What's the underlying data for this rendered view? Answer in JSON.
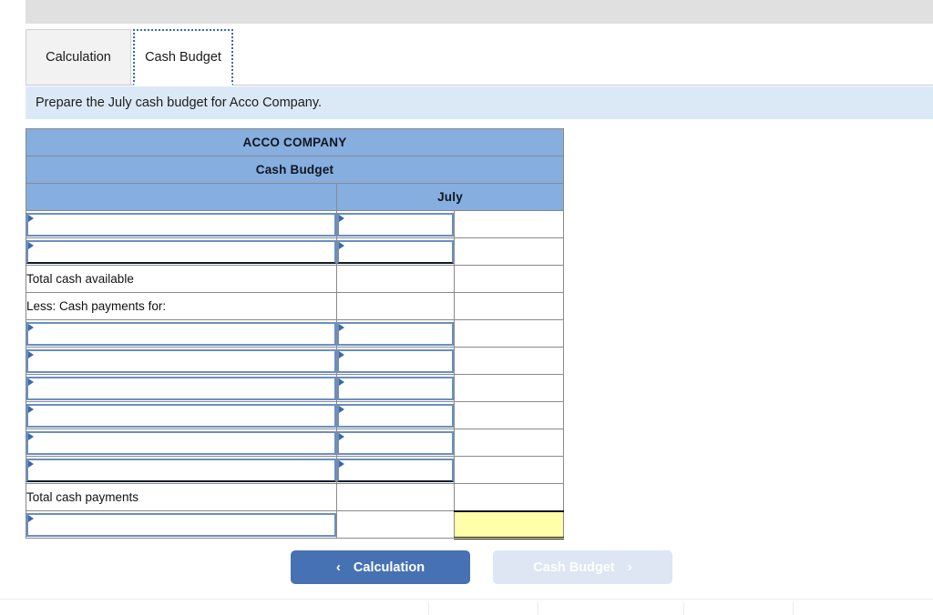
{
  "tabs": [
    {
      "label": "Calculation",
      "active": false
    },
    {
      "label": "Cash Budget",
      "active": true
    }
  ],
  "banner": {
    "text": "Prepare the July cash budget for Acco Company."
  },
  "sheet": {
    "company": "ACCO COMPANY",
    "statement": "Cash Budget",
    "blank_header": "",
    "period": "July",
    "rows": [
      {
        "kind": "input",
        "label": "",
        "b": "input",
        "c": "plain",
        "subline": false
      },
      {
        "kind": "input",
        "label": "",
        "b": "input",
        "c": "plain",
        "subline": true
      },
      {
        "kind": "label",
        "label": "Total cash available",
        "b": "plain",
        "c": "plain",
        "subline": false
      },
      {
        "kind": "label",
        "label": "Less: Cash payments for:",
        "b": "plain",
        "c": "plain",
        "subline": false
      },
      {
        "kind": "input",
        "label": "",
        "b": "input",
        "c": "plain",
        "subline": false
      },
      {
        "kind": "input",
        "label": "",
        "b": "input",
        "c": "plain",
        "subline": false
      },
      {
        "kind": "input",
        "label": "",
        "b": "input",
        "c": "plain",
        "subline": false
      },
      {
        "kind": "input",
        "label": "",
        "b": "input",
        "c": "plain",
        "subline": false
      },
      {
        "kind": "input",
        "label": "",
        "b": "input",
        "c": "plain",
        "subline": false
      },
      {
        "kind": "input",
        "label": "",
        "b": "input",
        "c": "plain",
        "subline": true
      },
      {
        "kind": "label",
        "label": "Total cash payments",
        "b": "plain",
        "c": "plain",
        "subline": false
      },
      {
        "kind": "input",
        "label": "",
        "b": "plain",
        "c": "highlight",
        "subline": false
      }
    ]
  },
  "nav": {
    "prev_label": "Calculation",
    "prev_icon": "chevron-left-icon",
    "prev_glyph": "‹",
    "next_label": "Cash Budget",
    "next_icon": "chevron-right-icon",
    "next_glyph": "›",
    "next_disabled": true
  },
  "colors": {
    "header_blue": "#86aede",
    "banner_blue": "#dbe9f6",
    "button_blue": "#4672b4",
    "button_disabled": "#dde6f2",
    "highlight_yellow": "#ffffaa",
    "input_border": "#6a8fc4"
  },
  "bottom_ticks": [
    470,
    590,
    750,
    870
  ]
}
